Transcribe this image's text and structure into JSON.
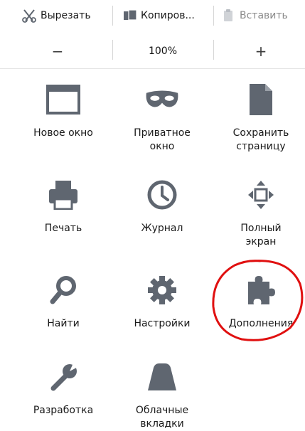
{
  "edit_controls": {
    "cut": {
      "label": "Вырезать",
      "icon": "scissors-icon"
    },
    "copy": {
      "label": "Копиров...",
      "icon": "copy-icon"
    },
    "paste": {
      "label": "Вставить",
      "icon": "clipboard-icon"
    }
  },
  "zoom_controls": {
    "minus": "−",
    "level": "100%",
    "plus": "+"
  },
  "menu_items": [
    {
      "label": "Новое окно",
      "icon": "window-icon"
    },
    {
      "label": "Приватное\nокно",
      "icon": "private-mask-icon"
    },
    {
      "label": "Сохранить\nстраницу",
      "icon": "page-icon"
    },
    {
      "label": "Печать",
      "icon": "printer-icon"
    },
    {
      "label": "Журнал",
      "icon": "clock-icon"
    },
    {
      "label": "Полный\nэкран",
      "icon": "fullscreen-icon"
    },
    {
      "label": "Найти",
      "icon": "search-icon"
    },
    {
      "label": "Настройки",
      "icon": "gear-icon"
    },
    {
      "label": "Дополнения",
      "icon": "puzzle-icon"
    },
    {
      "label": "Разработка",
      "icon": "wrench-icon"
    },
    {
      "label": "Облачные\nвкладки",
      "icon": "cloud-tabs-icon"
    }
  ],
  "colors": {
    "icon_gray": "#5f6670",
    "annotation_red": "#e01010"
  }
}
